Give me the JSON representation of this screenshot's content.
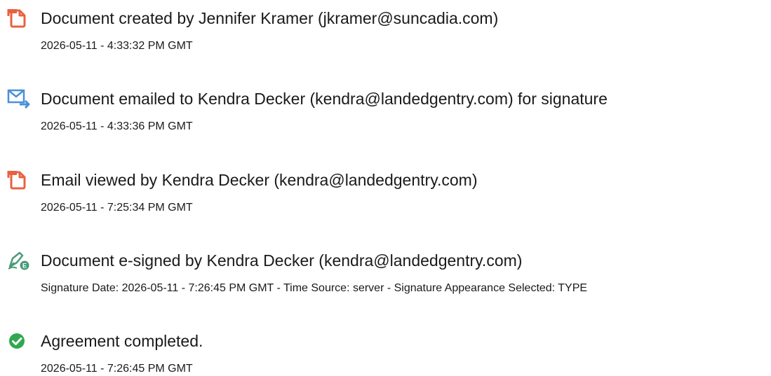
{
  "colors": {
    "document_icon": "#e8623f",
    "email_icon": "#4a90d9",
    "sign_icon": "#4a9a7a",
    "complete_icon": "#2fa84f",
    "text": "#1a1a1a"
  },
  "events": [
    {
      "icon": "document-icon",
      "title": "Document created by Jennifer Kramer (jkramer@suncadia.com)",
      "detail": "2026-05-11 - 4:33:32 PM GMT"
    },
    {
      "icon": "email-forward-icon",
      "title": "Document emailed to Kendra Decker (kendra@landedgentry.com) for signature",
      "detail": "2026-05-11 - 4:33:36 PM GMT"
    },
    {
      "icon": "document-icon",
      "title": "Email viewed by Kendra Decker (kendra@landedgentry.com)",
      "detail": "2026-05-11 - 7:25:34 PM GMT"
    },
    {
      "icon": "esign-pen-icon",
      "title": "Document e-signed by Kendra Decker (kendra@landedgentry.com)",
      "detail": "Signature Date: 2026-05-11 - 7:26:45 PM GMT - Time Source: server - Signature Appearance Selected: TYPE"
    },
    {
      "icon": "check-circle-icon",
      "title": "Agreement completed.",
      "detail": "2026-05-11 - 7:26:45 PM GMT"
    }
  ]
}
